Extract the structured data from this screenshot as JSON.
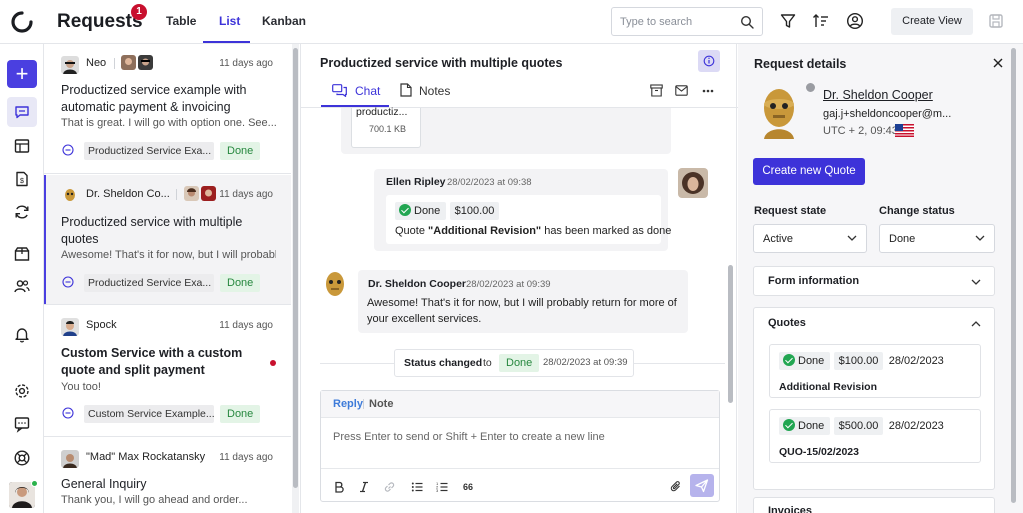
{
  "header": {
    "title": "Requests",
    "badge": "1",
    "tabs": [
      {
        "label": "Table"
      },
      {
        "label": "List"
      },
      {
        "label": "Kanban"
      }
    ],
    "active_tab": "List",
    "search_placeholder": "Type to search",
    "create_view_label": "Create View"
  },
  "accent_color": "#3d33d9",
  "requests": [
    {
      "name": "Neo",
      "date": "11 days ago",
      "title": "Productized service example with automatic payment & invoicing",
      "preview": "That is great. I will go with option one. See...",
      "service": "Productized Service Exa...",
      "status": "Done"
    },
    {
      "name": "Dr. Sheldon Co...",
      "date": "11 days ago",
      "title": "Productized service with multiple quotes",
      "preview": "Awesome! That's it for now, but I will probabl...",
      "service": "Productized Service Exa...",
      "status": "Done"
    },
    {
      "name": "Spock",
      "date": "11 days ago",
      "title": "Custom Service with a custom quote and split payment",
      "preview": "You too!",
      "service": "Custom Service Example...",
      "status": "Done"
    },
    {
      "name": "\"Mad\" Max Rockatansky",
      "date": "11 days ago",
      "title": "General Inquiry",
      "preview": "Thank you, I will go ahead and order..."
    }
  ],
  "chat": {
    "title": "Productized service with multiple quotes",
    "tabs": [
      {
        "label": "Chat"
      },
      {
        "label": "Notes"
      }
    ],
    "file": {
      "name": "productiz...",
      "size": "700.1 KB"
    },
    "messages": [
      {
        "author": "Ellen Ripley",
        "time": "28/02/2023 at 09:38",
        "status": "Done",
        "amount": "$100.00",
        "text_before": "Quote ",
        "text_bold": "\"Additional Revision\"",
        "text_after": " has been marked as done"
      },
      {
        "author": "Dr. Sheldon Cooper",
        "time": "28/02/2023 at 09:39",
        "text": "Awesome! That's it for now, but I will probably return for more of your excellent services."
      }
    ],
    "status_change": {
      "label": "Status changed",
      "to": "to",
      "status": "Done",
      "time": "28/02/2023 at 09:39"
    },
    "reply": {
      "reply_tab": "Reply",
      "note_tab": "Note",
      "placeholder": "Press Enter to send or Shift + Enter to create a new line",
      "quote_glyph": "66"
    }
  },
  "details": {
    "title": "Request details",
    "name": "Dr. Sheldon Cooper",
    "email": "gaj.j+sheldoncooper@m...",
    "timezone": "UTC + 2, 09:43",
    "create_quote_label": "Create new Quote",
    "request_state_label": "Request state",
    "request_state_value": "Active",
    "change_status_label": "Change status",
    "change_status_value": "Done",
    "form_info_label": "Form information",
    "quotes_label": "Quotes",
    "quotes": [
      {
        "status": "Done",
        "amount": "$100.00",
        "date": "28/02/2023",
        "label": "Additional Revision"
      },
      {
        "status": "Done",
        "amount": "$500.00",
        "date": "28/02/2023",
        "label": "QUO-15/02/2023"
      }
    ],
    "invoices_label": "Invoices"
  }
}
